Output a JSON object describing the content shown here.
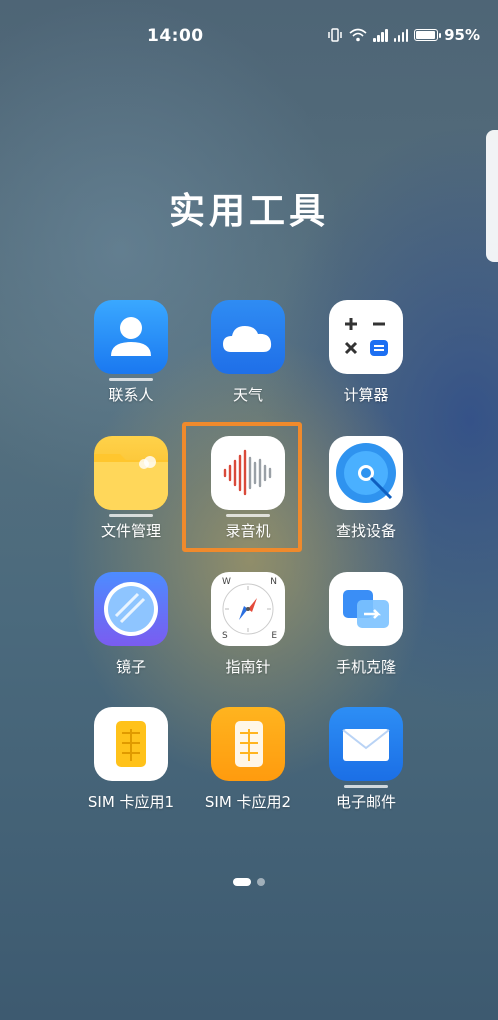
{
  "status_bar": {
    "time": "14:00",
    "battery_percent": "95%",
    "network_1": "4G",
    "network_2": "4G",
    "wifi_tag": "6"
  },
  "folder": {
    "title": "实用工具"
  },
  "apps": [
    {
      "label": "联系人",
      "icon": "contacts-icon"
    },
    {
      "label": "天气",
      "icon": "weather-icon"
    },
    {
      "label": "计算器",
      "icon": "calculator-icon"
    },
    {
      "label": "文件管理",
      "icon": "files-icon"
    },
    {
      "label": "录音机",
      "icon": "recorder-icon"
    },
    {
      "label": "查找设备",
      "icon": "find-device-icon"
    },
    {
      "label": "镜子",
      "icon": "mirror-icon"
    },
    {
      "label": "指南针",
      "icon": "compass-icon"
    },
    {
      "label": "手机克隆",
      "icon": "phone-clone-icon"
    },
    {
      "label": "SIM 卡应用1",
      "icon": "sim-card-1-icon"
    },
    {
      "label": "SIM 卡应用2",
      "icon": "sim-card-2-icon"
    },
    {
      "label": "电子邮件",
      "icon": "email-icon"
    }
  ],
  "compass_letters": {
    "n": "W",
    "e": "E",
    "s": "S",
    "w": "W2"
  },
  "page_indicator": {
    "pages": 2,
    "current": 1
  },
  "colors": {
    "highlight": "#f08a2c",
    "recorder_bars": "#d94a3a"
  }
}
